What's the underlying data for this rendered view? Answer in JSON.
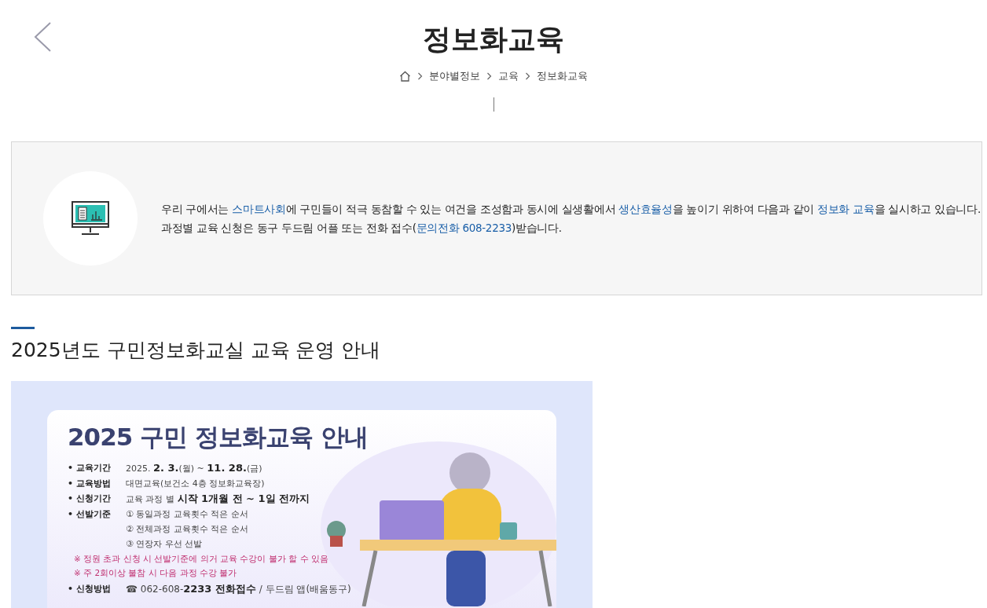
{
  "header": {
    "title": "정보화교육",
    "breadcrumb": [
      "분야별정보",
      "교육",
      "정보화교육"
    ]
  },
  "intro": {
    "lines": [
      [
        {
          "kind": "plain",
          "text": "우리 구에서는 "
        },
        {
          "kind": "highlight",
          "text": "스마트사회"
        },
        {
          "kind": "plain",
          "text": "에 구민들이 적극 동참할 수 있는 여건을 조성함과 동시에 실생활에서 "
        },
        {
          "kind": "highlight",
          "text": "생산효율성"
        },
        {
          "kind": "plain",
          "text": "을 높이기 위하여 다음과 같이 "
        },
        {
          "kind": "highlight",
          "text": "정보화 교육"
        },
        {
          "kind": "plain",
          "text": "을 실시하고 있습니다."
        }
      ],
      [
        {
          "kind": "plain",
          "text": "과정별 교육 신청은 동구 두드림 어플 또는 전화 접수("
        },
        {
          "kind": "highlight",
          "text": "문의전화 608-2233"
        },
        {
          "kind": "plain",
          "text": ")받습니다."
        }
      ]
    ]
  },
  "section": {
    "heading": "2025년도 구민정보화교실 교육 운영 안내"
  },
  "poster": {
    "title": "2025 구민 정보화교육 안내",
    "rows": [
      {
        "label": "• 교육기간",
        "values": [
          "2025. **2. 3.**(월) ~ **11. 28.**(금)"
        ]
      },
      {
        "label": "• 교육방법",
        "values": [
          "대면교육(보건소 4층 정보화교육장)"
        ]
      },
      {
        "label": "• 신청기간",
        "values": [
          "교육 과정 별 **시작 1개월 전 ~ 1일 전까지**"
        ]
      },
      {
        "label": "• 선발기준",
        "values": [
          "① 동일과정 교육횟수 적은 순서",
          "② 전체과정 교육횟수 적은 순서",
          "③ 연장자 우선 선발"
        ]
      }
    ],
    "notes": [
      "※ 정원 초과 신청 시 선발기준에 의거 교육 수강이 불가 할 수 있음",
      "※ 주 2회이상 불참 시 다음 과정 수강 불가"
    ],
    "apply": {
      "label": "• 신청방법",
      "value": "☎ 062-608-**2233 전화접수** / 두드림 앱(배움동구)"
    }
  }
}
